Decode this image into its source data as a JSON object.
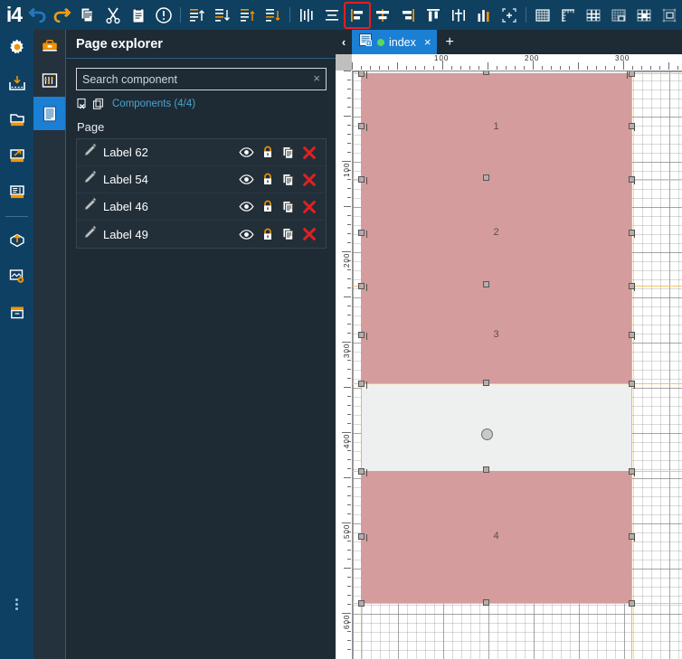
{
  "app": {
    "logo": "i4"
  },
  "toolbar": {
    "items": [
      {
        "name": "undo-icon",
        "label": "Undo"
      },
      {
        "name": "redo-icon",
        "label": "Redo"
      },
      {
        "name": "copy-icon",
        "label": "Copy"
      },
      {
        "name": "cut-icon",
        "label": "Cut"
      },
      {
        "name": "paste-icon",
        "label": "Paste"
      },
      {
        "name": "info-icon",
        "label": "Info"
      },
      {
        "name": "align-top-icon",
        "label": "Align top"
      },
      {
        "name": "align-bottom-icon",
        "label": "Align bottom"
      },
      {
        "name": "align-top-edges-icon",
        "label": "Align top edges"
      },
      {
        "name": "align-bottom-edges-icon",
        "label": "Align bottom edges"
      },
      {
        "name": "distribute-horizontal-icon",
        "label": "Distribute horizontally"
      },
      {
        "name": "distribute-vertical-center-icon",
        "label": "Distribute vertical center"
      },
      {
        "name": "align-left-icon",
        "label": "Align left"
      },
      {
        "name": "align-center-icon",
        "label": "Align center"
      },
      {
        "name": "align-right-icon",
        "label": "Align right"
      },
      {
        "name": "align-top-bar-icon",
        "label": "Align top bar"
      },
      {
        "name": "distribute-centers-icon",
        "label": "Distribute centers"
      },
      {
        "name": "distribute-space-icon",
        "label": "Distribute space"
      },
      {
        "name": "fit-selection-icon",
        "label": "Fit selection"
      },
      {
        "name": "grid-icon",
        "label": "Grid"
      },
      {
        "name": "ruler-icon",
        "label": "Ruler"
      },
      {
        "name": "grid-lines-icon",
        "label": "Grid lines"
      },
      {
        "name": "grid-snap-icon",
        "label": "Snap to grid"
      },
      {
        "name": "grid-center-icon",
        "label": "Grid center"
      },
      {
        "name": "selection-bounds-icon",
        "label": "Selection bounds"
      }
    ],
    "selected_index": 12
  },
  "rail": {
    "items": [
      {
        "name": "sidebar-item-settings",
        "label": "Settings"
      },
      {
        "name": "sidebar-item-import",
        "label": "Import"
      },
      {
        "name": "sidebar-item-project",
        "label": "Project"
      },
      {
        "name": "sidebar-item-export",
        "label": "Export"
      },
      {
        "name": "sidebar-item-pages",
        "label": "Pages"
      },
      {
        "name": "sidebar-item-deploy",
        "label": "Deploy"
      },
      {
        "name": "sidebar-item-media-settings",
        "label": "Media settings"
      },
      {
        "name": "sidebar-item-archive",
        "label": "Archive"
      }
    ],
    "overflow_label": "More"
  },
  "rail2": {
    "items": [
      {
        "name": "tool-toolbox",
        "label": "Toolbox"
      },
      {
        "name": "tool-properties",
        "label": "Properties"
      },
      {
        "name": "tool-page-explorer",
        "label": "Page explorer"
      }
    ],
    "active_index": 2
  },
  "panel": {
    "title": "Page explorer",
    "search": {
      "value": "",
      "placeholder": "Search component",
      "clear": "×"
    },
    "components_label": "Components (4/4)",
    "page_label": "Page",
    "rows": [
      {
        "name": "Label 62"
      },
      {
        "name": "Label 54"
      },
      {
        "name": "Label 46"
      },
      {
        "name": "Label 49"
      }
    ],
    "row_actions": [
      "visibility-icon",
      "lock-icon",
      "duplicate-icon",
      "delete-icon"
    ]
  },
  "editor": {
    "tab_back": "‹",
    "tab": {
      "title": "index",
      "close": "×",
      "status": "modified"
    },
    "tab_add": "+",
    "ruler_h_labels": [
      "100",
      "200",
      "300"
    ],
    "ruler_v_labels": [
      "100",
      "200",
      "300",
      "400",
      "500",
      "600"
    ],
    "shapes": [
      {
        "label": "1"
      },
      {
        "label": "2"
      },
      {
        "label": "3"
      },
      {
        "label": "4"
      }
    ]
  },
  "colors": {
    "toolbar_bg": "#10405f",
    "rail_bg": "#0e4064",
    "rail2_bg": "#23323c",
    "panel_bg": "#1e2b35",
    "accent_blue": "#1b7fd4",
    "link_blue": "#4ba3cf",
    "orange": "#f29400",
    "shape_fill": "#d49c9c",
    "guide": "#e8b953",
    "delete_red": "#e02020",
    "selection_red": "#ee1c1c",
    "status_green": "#5cd65c"
  }
}
